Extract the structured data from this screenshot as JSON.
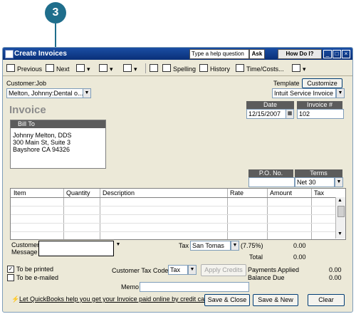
{
  "callout": {
    "number": "3",
    "color": "#1f6e8c"
  },
  "window": {
    "title": "Create Invoices",
    "help_placeholder": "Type a help question",
    "ask_label": "Ask",
    "how_do_i_label": "How Do I?"
  },
  "toolbar": {
    "previous": "Previous",
    "next": "Next",
    "spelling": "Spelling",
    "history": "History",
    "time_costs": "Time/Costs..."
  },
  "customer": {
    "label": "Customer:Job",
    "value": "Melton, Johnny:Dental o..."
  },
  "template": {
    "label": "Template",
    "customize": "Customize",
    "value": "Intuit Service Invoice"
  },
  "invoice": {
    "title": "Invoice",
    "date_label": "Date",
    "date_value": "12/15/2007",
    "number_label": "Invoice #",
    "number_value": "102",
    "bill_to_label": "Bill To",
    "bill_to_lines": [
      "Johnny Melton, DDS",
      "300 Main St, Suite 3",
      "Bayshore CA 94326"
    ],
    "po_label": "P.O. No.",
    "terms_label": "Terms",
    "terms_value": "Net 30"
  },
  "grid": {
    "columns": [
      "Item",
      "Quantity",
      "Description",
      "Rate",
      "Amount",
      "Tax"
    ]
  },
  "footer": {
    "customer_message_label_1": "Customer",
    "customer_message_label_2": "Message",
    "tax_label": "Tax",
    "tax_value": "San Tomas",
    "tax_rate": "(7.75%)",
    "tax_amount": "0.00",
    "total_label": "Total",
    "total_value": "0.00",
    "to_be_printed": "To be printed",
    "to_be_emailed": "To be e-mailed",
    "customer_tax_code_label": "Customer Tax Code",
    "customer_tax_code_value": "Tax",
    "apply_credits": "Apply Credits",
    "payments_applied_label": "Payments Applied",
    "payments_applied_value": "0.00",
    "balance_due_label": "Balance Due",
    "balance_due_value": "0.00",
    "memo_label": "Memo",
    "online_link": "Let QuickBooks help you get your Invoice paid online by credit card.",
    "save_close": "Save & Close",
    "save_new": "Save & New",
    "clear": "Clear"
  }
}
